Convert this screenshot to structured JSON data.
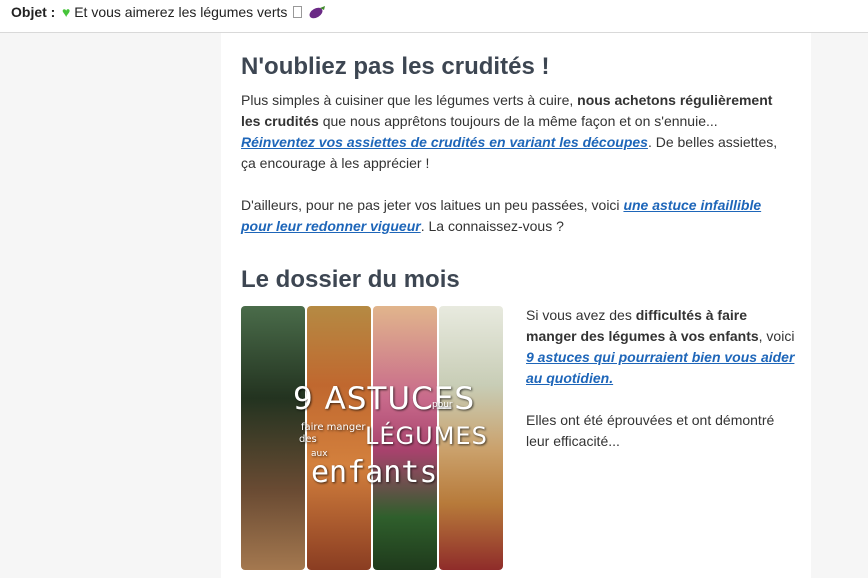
{
  "email": {
    "subject_label": "Objet :",
    "subject_text": "Et vous aimerez les légumes verts",
    "subject_icons": [
      "green-heart-emoji",
      "missing-glyph-box",
      "eggplant-emoji"
    ]
  },
  "section1": {
    "title": "N'oubliez pas les crudités !",
    "p1_part1": "Plus simples à cuisiner que les légumes verts à cuire, ",
    "p1_bold1": "nous achetons régulièrement",
    "p1_bold2": "les crudités",
    "p1_part2": " que nous apprêtons toujours de la même façon et on s'ennuie...",
    "p1_link": "Réinventez vos assiettes de crudités en variant les découpes",
    "p1_part3": ". De belles assiettes, ça encourage à les apprécier !",
    "p2_part1": "D'ailleurs, pour ne pas jeter vos laitues un peu passées, voici ",
    "p2_link": "une astuce infaillible pour leur redonner vigueur",
    "p2_part2": ". La connaissez-vous ?"
  },
  "section2": {
    "title": "Le dossier du mois",
    "image_lines": {
      "line1": "9 ASTUCES",
      "pour": "pour",
      "faire_manger": "faire manger",
      "des": "des",
      "legumes": "LÉGUMES",
      "aux": "aux",
      "enfants": "enfants"
    },
    "side_part1": "Si vous avez des ",
    "side_bold": "difficultés à faire manger des légumes à vos enfants",
    "side_part2": ", voici ",
    "side_link": "9 astuces qui pourraient bien vous aider au quotidien.",
    "side_p2": "Elles ont été éprouvées et ont démontré leur efficacité..."
  },
  "colors": {
    "link": "#1e66b9",
    "heading": "#3d4652",
    "page_bg": "#f6f6f6",
    "card_bg": "#ffffff"
  }
}
